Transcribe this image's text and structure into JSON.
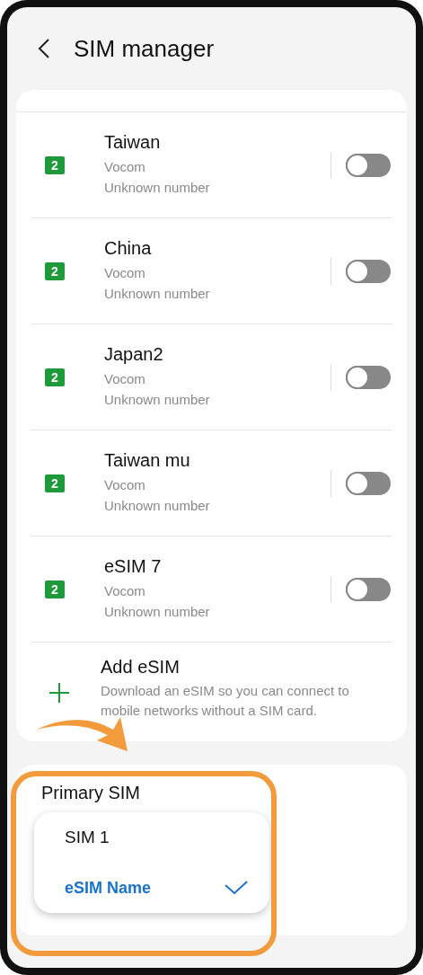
{
  "header": {
    "title": "SIM manager"
  },
  "sims": [
    {
      "name": "Taiwan",
      "carrier": "Vocom",
      "number": "Unknown number",
      "sim_slot": "2",
      "on": false
    },
    {
      "name": "China",
      "carrier": "Vocom",
      "number": "Unknown number",
      "sim_slot": "2",
      "on": false
    },
    {
      "name": "Japan2",
      "carrier": "Vocom",
      "number": "Unknown number",
      "sim_slot": "2",
      "on": false
    },
    {
      "name": "Taiwan mu",
      "carrier": "Vocom",
      "number": "Unknown number",
      "sim_slot": "2",
      "on": false
    },
    {
      "name": "eSIM 7",
      "carrier": "Vocom",
      "number": "Unknown number",
      "sim_slot": "2",
      "on": false
    }
  ],
  "add_esim": {
    "title": "Add eSIM",
    "description": "Download an eSIM so you can connect to mobile networks without a SIM card."
  },
  "primary_sim": {
    "label": "Primary SIM",
    "options": [
      {
        "label": "SIM 1",
        "selected": false
      },
      {
        "label": "eSIM Name",
        "selected": true
      }
    ]
  }
}
